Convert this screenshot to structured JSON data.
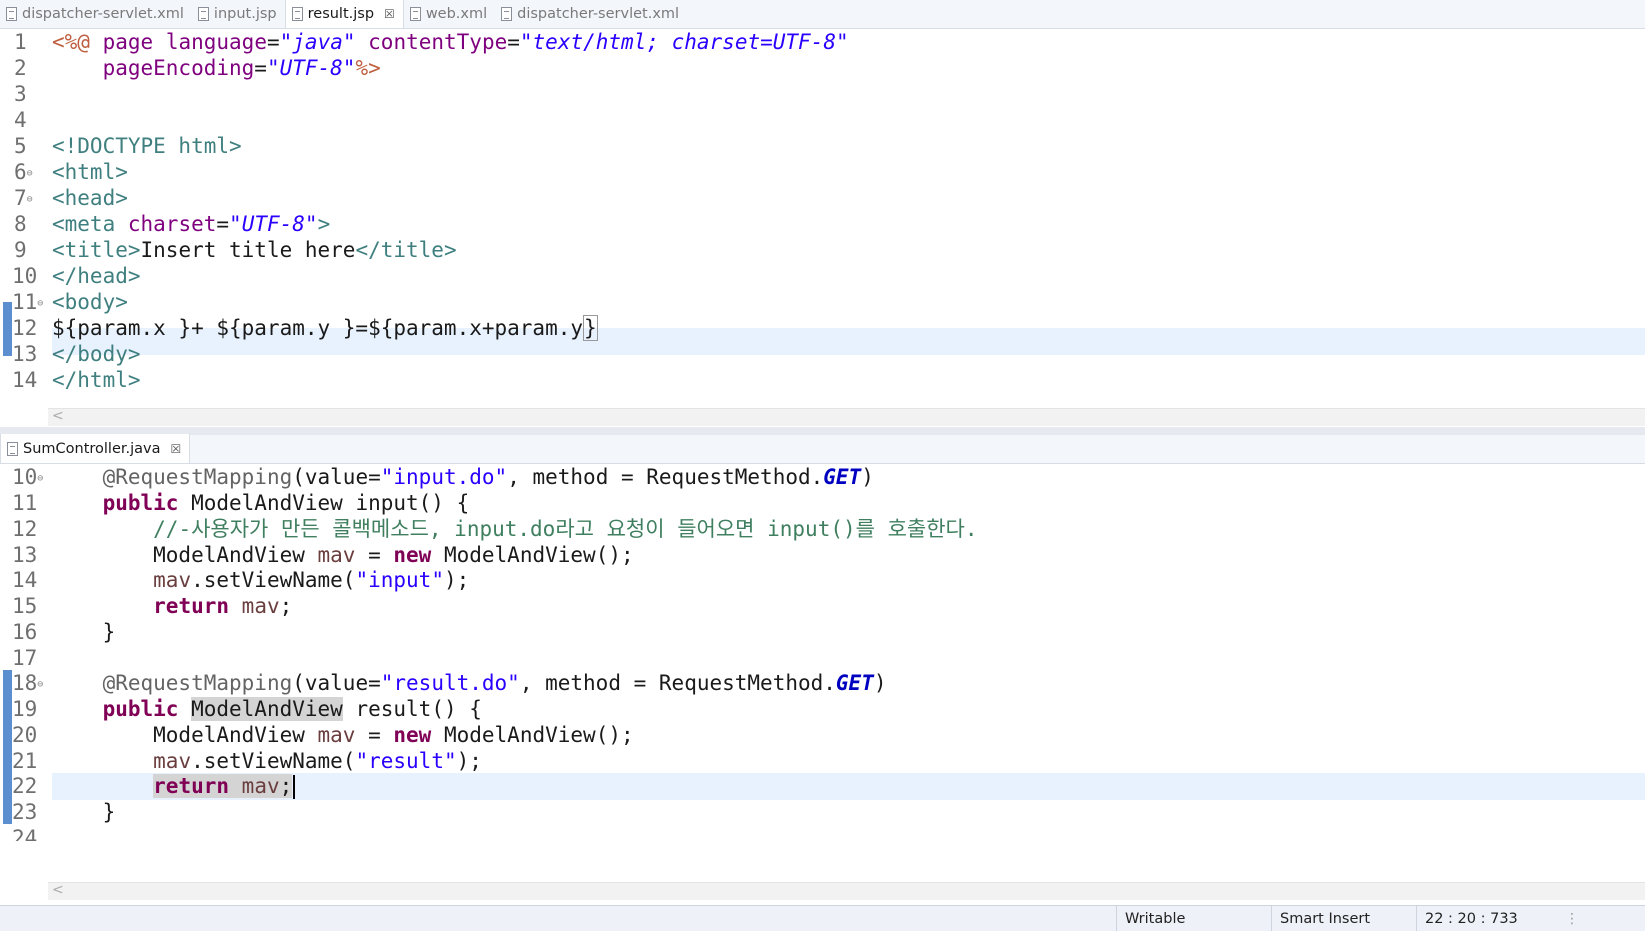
{
  "top_editor": {
    "tabs": [
      {
        "label": "dispatcher-servlet.xml",
        "active": false
      },
      {
        "label": "input.jsp",
        "active": false
      },
      {
        "label": "result.jsp",
        "active": true,
        "close": "☒"
      },
      {
        "label": "web.xml",
        "active": false
      },
      {
        "label": "dispatcher-servlet.xml",
        "active": false
      }
    ],
    "line_numbers": [
      "1",
      "2",
      "3",
      "4",
      "5",
      "6",
      "7",
      "8",
      "9",
      "10",
      "11",
      "12",
      "13",
      "14"
    ],
    "current_line": "12"
  },
  "bottom_editor": {
    "tab": {
      "label": "SumController.java",
      "close": "☒"
    },
    "line_numbers": [
      "10",
      "11",
      "12",
      "13",
      "14",
      "15",
      "16",
      "17",
      "18",
      "19",
      "20",
      "21",
      "22",
      "23",
      "24"
    ],
    "current_line": "22"
  },
  "scroll_arrow": "<",
  "statusbar": {
    "writable": "Writable",
    "insert_mode": "Smart Insert",
    "position": "22 : 20 : 733"
  },
  "colors": {
    "keyword": "#7f0055",
    "string": "#2a00ff",
    "comment": "#3f7f5f",
    "tag": "#3f7f7f",
    "attribute": "#7f007f",
    "current_line": "#e8f2fe",
    "change_marker": "#5b8fd0"
  }
}
